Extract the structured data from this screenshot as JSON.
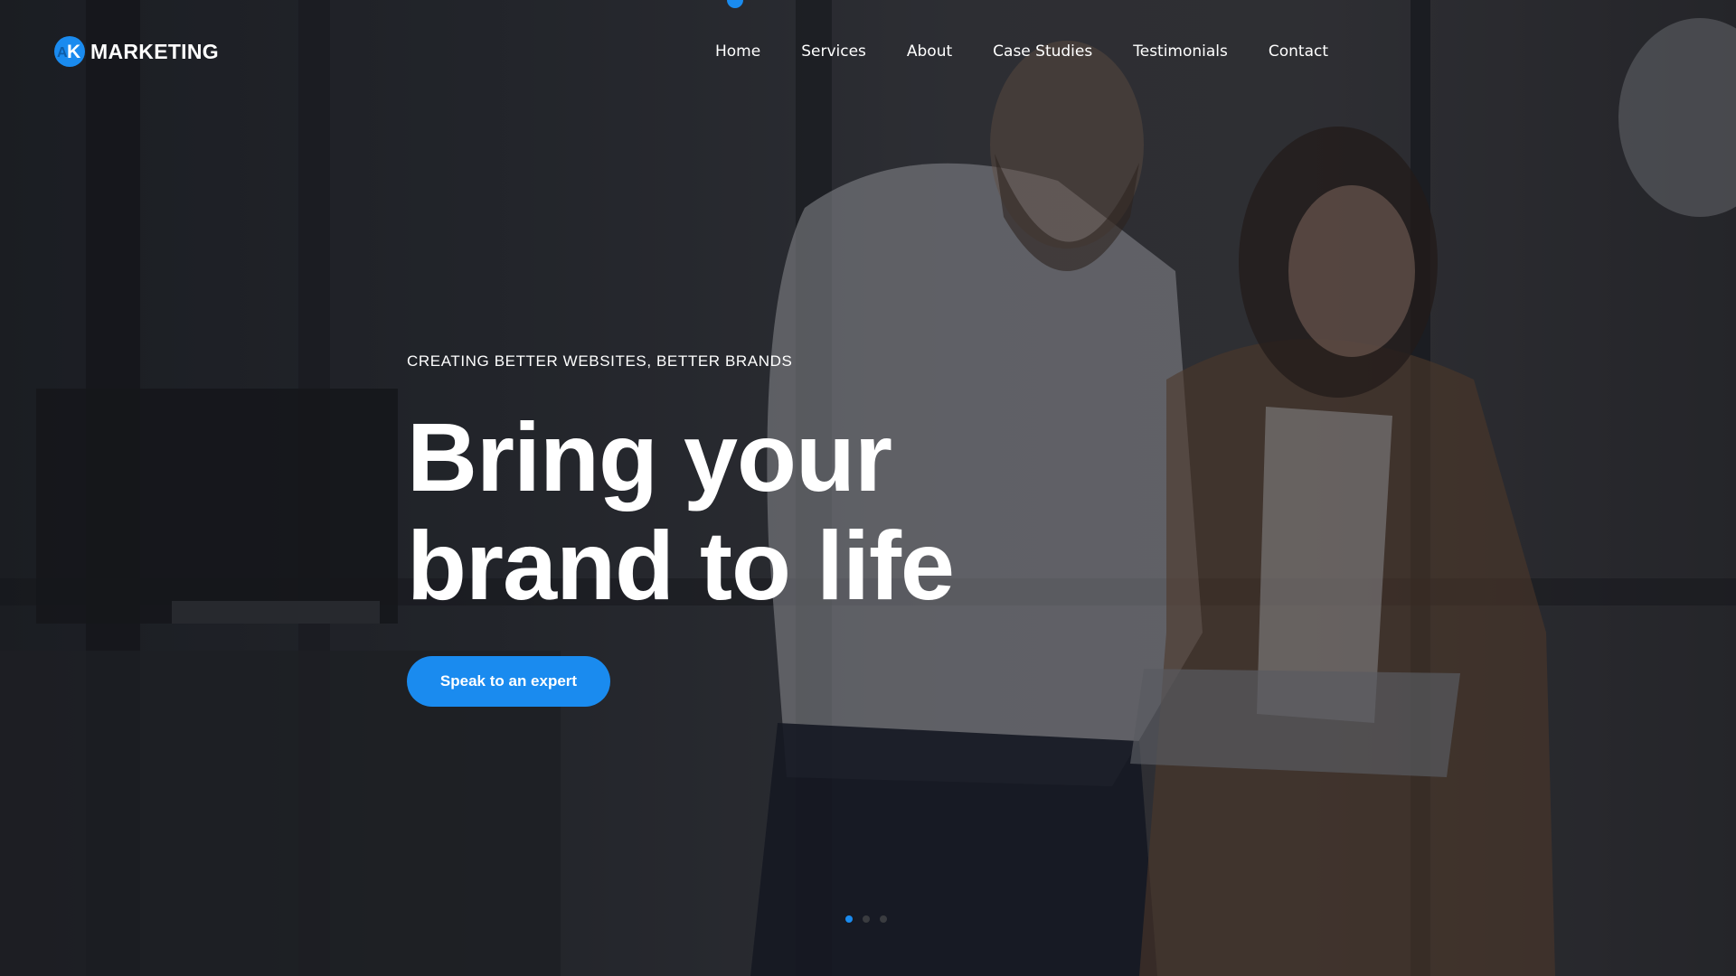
{
  "brand": {
    "logo_letters": "AK",
    "name": "MARKETING",
    "accent_color": "#1a8bef"
  },
  "nav": {
    "items": [
      {
        "label": "Home"
      },
      {
        "label": "Services"
      },
      {
        "label": "About"
      },
      {
        "label": "Case Studies"
      },
      {
        "label": "Testimonials"
      },
      {
        "label": "Contact"
      }
    ]
  },
  "hero": {
    "eyebrow": "CREATING BETTER WEBSITES, BETTER BRANDS",
    "headline_line1": "Bring your",
    "headline_line2": "brand to life",
    "cta_label": "Speak to an expert",
    "background_image": "two-people-looking-at-tablet-office-photo"
  },
  "slider": {
    "slide_count": 3,
    "active_index": 0
  }
}
